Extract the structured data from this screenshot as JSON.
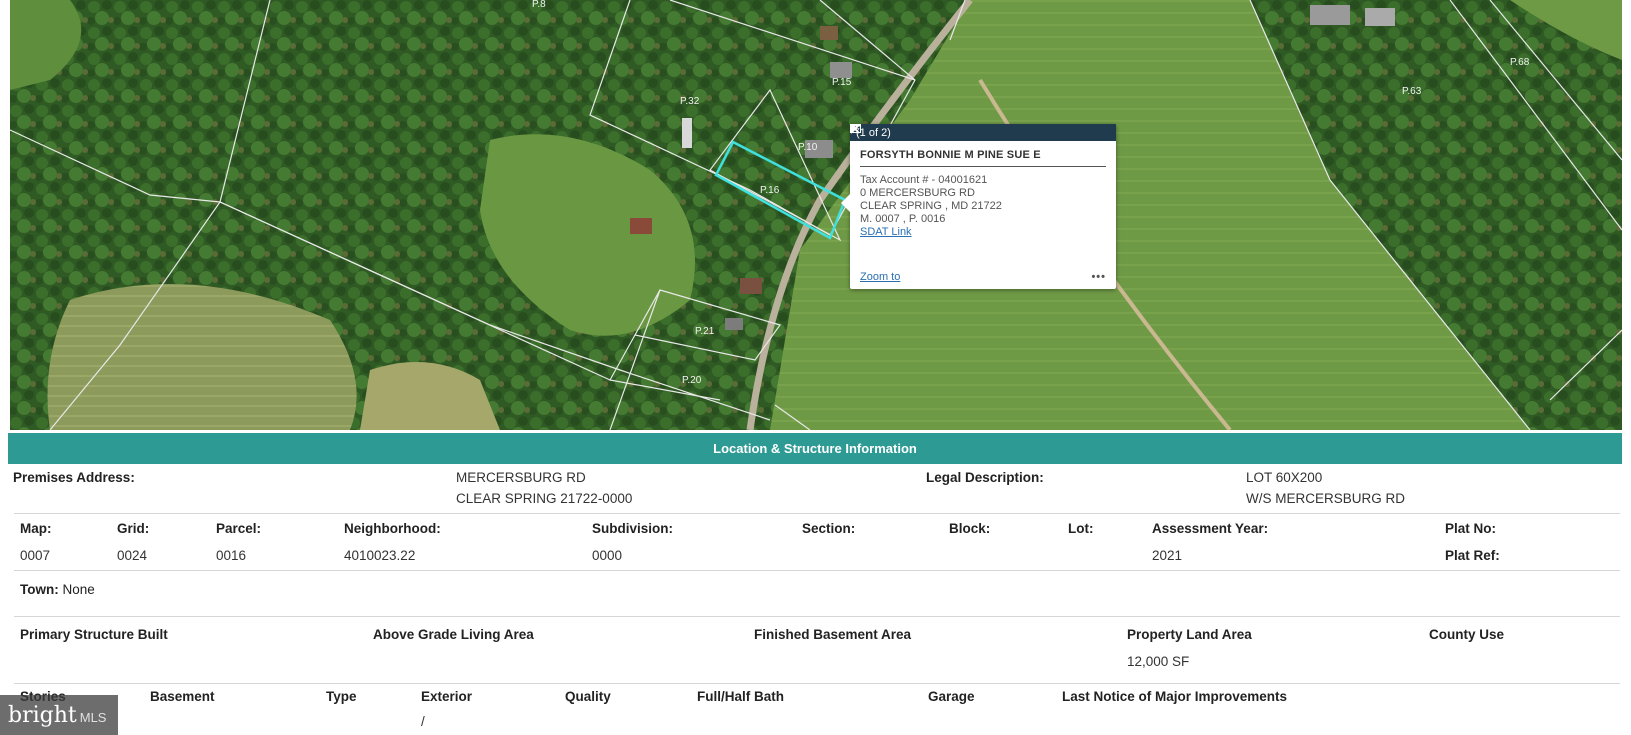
{
  "map": {
    "parcel_labels": [
      "P.8",
      "P.32",
      "P.15",
      "P.10",
      "P.16",
      "P.21",
      "P.20",
      "P.63",
      "P.68"
    ],
    "colors": {
      "highlight": "#3fe0e0",
      "lines": "#e8e8e8"
    }
  },
  "popup": {
    "count": "(1 of 2)",
    "next_icon": "play-icon",
    "maximize_icon": "maximize-icon",
    "close_icon": "close-icon",
    "owner": "FORSYTH BONNIE M PINE SUE E",
    "tax_account": "Tax Account # - 04001621",
    "address_line1": "0 MERCERSBURG RD",
    "address_line2": "CLEAR SPRING , MD  21722",
    "map_parcel": "M. 0007 , P. 0016",
    "sdat_link": "SDAT Link",
    "zoom_to": "Zoom to",
    "more": "•••"
  },
  "section": {
    "title": "Location & Structure Information",
    "color": "#2e9a94"
  },
  "premises": {
    "label": "Premises Address:",
    "line1": "MERCERSBURG RD",
    "line2": "CLEAR SPRING 21722-0000",
    "legal_label": "Legal Description:",
    "legal_line1": "LOT 60X200",
    "legal_line2": "W/S MERCERSBURG RD"
  },
  "parcel_info": {
    "map_label": "Map:",
    "map_value": "0007",
    "grid_label": "Grid:",
    "grid_value": "0024",
    "parcel_label": "Parcel:",
    "parcel_value": "0016",
    "neighborhood_label": "Neighborhood:",
    "neighborhood_value": "4010023.22",
    "subdivision_label": "Subdivision:",
    "subdivision_value": "0000",
    "section_label": "Section:",
    "block_label": "Block:",
    "lot_label": "Lot:",
    "assessment_label": "Assessment Year:",
    "assessment_value": "2021",
    "plat_no_label": "Plat No:",
    "plat_ref_label": "Plat Ref:"
  },
  "town": {
    "label": "Town:",
    "value": "None"
  },
  "structure": {
    "built_label": "Primary Structure Built",
    "living_label": "Above Grade Living Area",
    "basement_area_label": "Finished Basement Area",
    "land_label": "Property Land Area",
    "land_value": "12,000 SF",
    "county_use_label": "County Use"
  },
  "details": {
    "stories_label": "Stories",
    "basement_label": "Basement",
    "type_label": "Type",
    "exterior_label": "Exterior",
    "exterior_value": "/",
    "quality_label": "Quality",
    "bath_label": "Full/Half Bath",
    "garage_label": "Garage",
    "improvements_label": "Last Notice of Major Improvements"
  },
  "watermark": {
    "brand": "bright",
    "suffix": "MLS"
  }
}
